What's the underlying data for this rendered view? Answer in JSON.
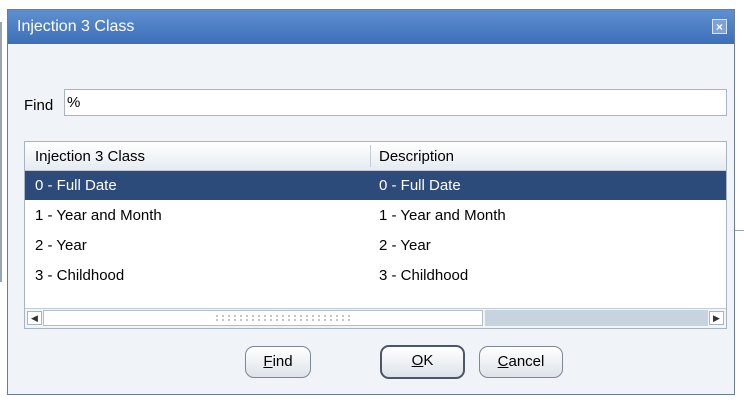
{
  "dialog": {
    "title": "Injection 3 Class",
    "close_icon": "close-icon"
  },
  "find": {
    "label": "Find",
    "value": "%"
  },
  "table": {
    "headers": [
      "Injection 3 Class",
      "Description"
    ],
    "rows": [
      {
        "class": "0 - Full Date",
        "description": "0 - Full Date",
        "selected": true
      },
      {
        "class": "1 - Year and Month",
        "description": "1 - Year and Month",
        "selected": false
      },
      {
        "class": "2 - Year",
        "description": "2 - Year",
        "selected": false
      },
      {
        "class": "3 - Childhood",
        "description": "3 - Childhood",
        "selected": false
      }
    ],
    "scrollbar": {
      "left_arrow": "◀",
      "right_arrow": "▶"
    }
  },
  "buttons": {
    "find": {
      "mnemonic": "F",
      "rest": "ind"
    },
    "ok": {
      "mnemonic": "O",
      "rest": "K"
    },
    "cancel": {
      "mnemonic": "C",
      "rest": "ancel"
    }
  },
  "colors": {
    "titlebar": "#3c6fb9",
    "selection": "#2c4a7a",
    "dialog_bg": "#f0f3f7"
  }
}
